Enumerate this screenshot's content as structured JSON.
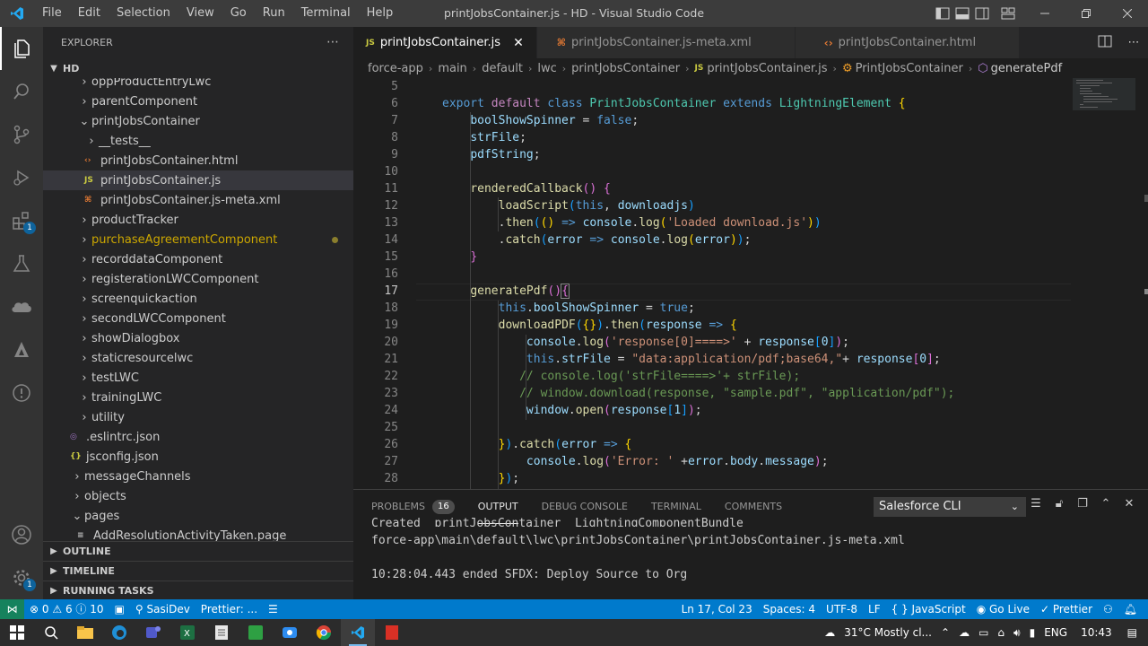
{
  "window": {
    "title": "printJobsContainer.js - HD - Visual Studio Code"
  },
  "menu": [
    "File",
    "Edit",
    "Selection",
    "View",
    "Go",
    "Run",
    "Terminal",
    "Help"
  ],
  "activity": {
    "extensions_badge": "1",
    "accounts_badge": "1"
  },
  "sidebar": {
    "title": "EXPLORER",
    "root": "HD",
    "items": [
      {
        "label": "oppProductEntryLwc",
        "kind": "folder",
        "depth": 1
      },
      {
        "label": "parentComponent",
        "kind": "folder",
        "depth": 1
      },
      {
        "label": "printJobsContainer",
        "kind": "folder-open",
        "depth": 1
      },
      {
        "label": "__tests__",
        "kind": "folder",
        "depth": 2
      },
      {
        "label": "printJobsContainer.html",
        "kind": "html",
        "depth": 2
      },
      {
        "label": "printJobsContainer.js",
        "kind": "js",
        "depth": 2
      },
      {
        "label": "printJobsContainer.js-meta.xml",
        "kind": "xml",
        "depth": 2
      },
      {
        "label": "productTracker",
        "kind": "folder",
        "depth": 1
      },
      {
        "label": "purchaseAgreementComponent",
        "kind": "folder",
        "depth": 1
      },
      {
        "label": "recorddataComponent",
        "kind": "folder",
        "depth": 1
      },
      {
        "label": "registerationLWCComponent",
        "kind": "folder",
        "depth": 1
      },
      {
        "label": "screenquickaction",
        "kind": "folder",
        "depth": 1
      },
      {
        "label": "secondLWCComponent",
        "kind": "folder",
        "depth": 1
      },
      {
        "label": "showDialogbox",
        "kind": "folder",
        "depth": 1
      },
      {
        "label": "staticresourcelwc",
        "kind": "folder",
        "depth": 1
      },
      {
        "label": "testLWC",
        "kind": "folder",
        "depth": 1
      },
      {
        "label": "trainingLWC",
        "kind": "folder",
        "depth": 1
      },
      {
        "label": "utility",
        "kind": "folder",
        "depth": 1
      },
      {
        "label": ".eslintrc.json",
        "kind": "eslint",
        "depth": 0
      },
      {
        "label": "jsconfig.json",
        "kind": "json",
        "depth": 0
      },
      {
        "label": "messageChannels",
        "kind": "folder",
        "depth": 0
      },
      {
        "label": "objects",
        "kind": "folder",
        "depth": 0
      },
      {
        "label": "pages",
        "kind": "folder-open",
        "depth": 0
      },
      {
        "label": "AddResolutionActivityTaken.page",
        "kind": "page",
        "depth": 1
      }
    ],
    "sections": [
      "OUTLINE",
      "TIMELINE",
      "RUNNING TASKS"
    ]
  },
  "tabs": [
    {
      "label": "printJobsContainer.js",
      "icon": "JS",
      "active": true
    },
    {
      "label": "printJobsContainer.js-meta.xml",
      "icon": "xml",
      "active": false
    },
    {
      "label": "printJobsContainer.html",
      "icon": "html",
      "active": false
    }
  ],
  "breadcrumb": [
    "force-app",
    "main",
    "default",
    "lwc",
    "printJobsContainer",
    "printJobsContainer.js",
    "PrintJobsContainer",
    "generatePdf"
  ],
  "editor": {
    "line_numbers": [
      "5",
      "6",
      "7",
      "8",
      "9",
      "10",
      "11",
      "12",
      "13",
      "14",
      "15",
      "16",
      "17",
      "18",
      "19",
      "20",
      "21",
      "22",
      "23",
      "24",
      "25",
      "26",
      "27",
      "28"
    ],
    "current_line": "17"
  },
  "panel": {
    "tabs": [
      "PROBLEMS",
      "OUTPUT",
      "DEBUG CONSOLE",
      "TERMINAL",
      "COMMENTS"
    ],
    "problems_count": "16",
    "active_tab": "OUTPUT",
    "channel": "Salesforce CLI",
    "output_lines": [
      "Created  printJobsContainer  LightningComponentBundle",
      "force-app\\main\\default\\lwc\\printJobsContainer\\printJobsContainer.js-meta.xml",
      "",
      "10:28:04.443 ended SFDX: Deploy Source to Org"
    ]
  },
  "status": {
    "errors": "0",
    "warnings": "6",
    "info": "10",
    "org": "SasiDev",
    "prettier_left": "Prettier: ...",
    "cursor": "Ln 17, Col 23",
    "spaces": "Spaces: 4",
    "encoding": "UTF-8",
    "eol": "LF",
    "language": "JavaScript",
    "golive": "Go Live",
    "prettier": "Prettier"
  },
  "taskbar": {
    "weather": "31°C  Mostly cl...",
    "lang": "ENG",
    "time": "10:43"
  }
}
